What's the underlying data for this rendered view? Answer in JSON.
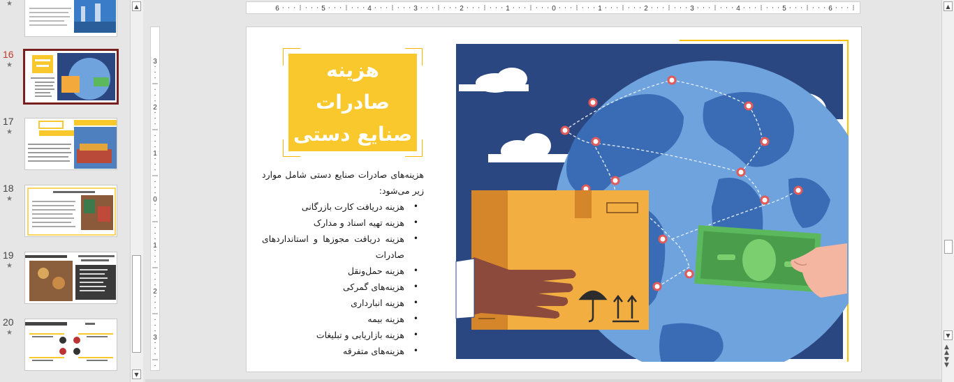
{
  "thumbnails": [
    {
      "num": "",
      "star": "★"
    },
    {
      "num": "16",
      "star": "★"
    },
    {
      "num": "17",
      "star": "★"
    },
    {
      "num": "18",
      "star": "★"
    },
    {
      "num": "19",
      "star": "★"
    },
    {
      "num": "20",
      "star": "★"
    }
  ],
  "ruler": {
    "h_labels": [
      "6",
      "5",
      "4",
      "3",
      "2",
      "1",
      "0",
      "1",
      "2",
      "3",
      "4",
      "5",
      "6"
    ],
    "v_labels": [
      "3",
      "2",
      "1",
      "0",
      "1",
      "2",
      "3"
    ]
  },
  "slide": {
    "title_line1": "هزینه صادرات",
    "title_line2": "صنایع دستی",
    "intro": "هزینه‌های صادرات صنایع دستی شامل موارد زیر می‌شود:",
    "bullets": [
      "هزینه دریافت کارت بازرگانی",
      "هزینه تهیه اسناد و مدارک",
      "هزینه دریافت مجوزها و استانداردهای صادرات",
      "هزینه حمل‌ونقل",
      "هزینه‌های گمرکی",
      "هزینه انبارداری",
      "هزینه بیمه",
      "هزینه بازاریابی و تبلیغات",
      "هزینه‌های متفرقه"
    ]
  },
  "colors": {
    "accent_yellow": "#f9c82c",
    "frame_yellow": "#ffc000",
    "navy": "#2b4781",
    "globe": "#6ea3de",
    "land": "#3a6cb5"
  },
  "icons": [
    "star-icon",
    "scroll-up-icon",
    "scroll-down-icon",
    "prev-slide-icon",
    "next-slide-icon"
  ]
}
